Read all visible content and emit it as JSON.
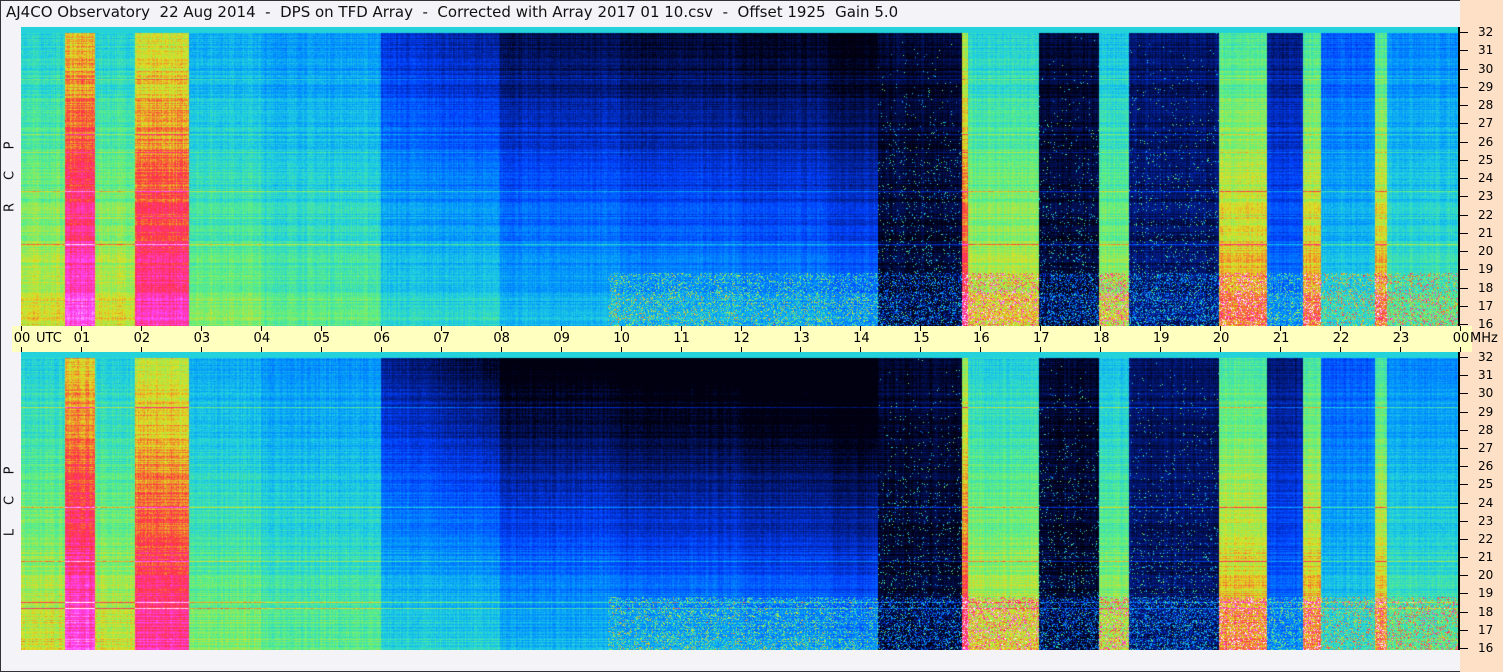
{
  "title": "AJ4CO Observatory  22 Aug 2014  -  DPS on TFD Array  -  Corrected with Array 2017 01 10.csv  -  Offset 1925  Gain 5.0",
  "chart_data": {
    "type": "heatmap",
    "title": "AJ4CO Observatory  22 Aug 2014  -  DPS on TFD Array  -  Corrected with Array 2017 01 10.csv  -  Offset 1925  Gain 5.0",
    "xlabel": "UTC",
    "ylabel": "MHz",
    "x_ticks": [
      "00",
      "01",
      "02",
      "03",
      "04",
      "05",
      "06",
      "07",
      "08",
      "09",
      "10",
      "11",
      "12",
      "13",
      "14",
      "15",
      "16",
      "17",
      "18",
      "19",
      "20",
      "21",
      "22",
      "23",
      "00"
    ],
    "x_range_hours": [
      0,
      24
    ],
    "y_ticks": [
      "32",
      "31",
      "30",
      "29",
      "28",
      "27",
      "26",
      "25",
      "24",
      "23",
      "22",
      "21",
      "20",
      "19",
      "18",
      "17",
      "16"
    ],
    "y_range_mhz": [
      16,
      32
    ],
    "panels": [
      {
        "name": "RCP",
        "label_letters": [
          "R",
          "C",
          "P"
        ]
      },
      {
        "name": "LCP",
        "label_letters": [
          "L",
          "C",
          "P"
        ]
      }
    ],
    "colormap": [
      "#000010",
      "#001a80",
      "#0040ff",
      "#0090ff",
      "#20d0e0",
      "#60f080",
      "#e0e020",
      "#ff3040",
      "#ff40ff",
      "#ffffff"
    ],
    "intensity_profile_hours": [
      [
        0.0,
        0.55
      ],
      [
        0.73,
        0.78
      ],
      [
        1.23,
        0.55
      ],
      [
        1.9,
        0.74
      ],
      [
        2.8,
        0.48
      ],
      [
        4.0,
        0.44
      ],
      [
        6.0,
        0.36
      ],
      [
        8.0,
        0.3
      ],
      [
        10.0,
        0.27
      ],
      [
        12.0,
        0.25
      ],
      [
        13.5,
        0.22
      ],
      [
        14.3,
        0.03
      ],
      [
        15.7,
        0.7
      ],
      [
        15.8,
        0.55
      ],
      [
        17.0,
        0.03
      ],
      [
        18.0,
        0.52
      ],
      [
        18.5,
        0.08
      ],
      [
        20.0,
        0.62
      ],
      [
        20.8,
        0.2
      ],
      [
        21.4,
        0.62
      ],
      [
        21.7,
        0.35
      ],
      [
        22.6,
        0.62
      ],
      [
        22.8,
        0.42
      ],
      [
        24.0,
        0.42
      ]
    ]
  }
}
